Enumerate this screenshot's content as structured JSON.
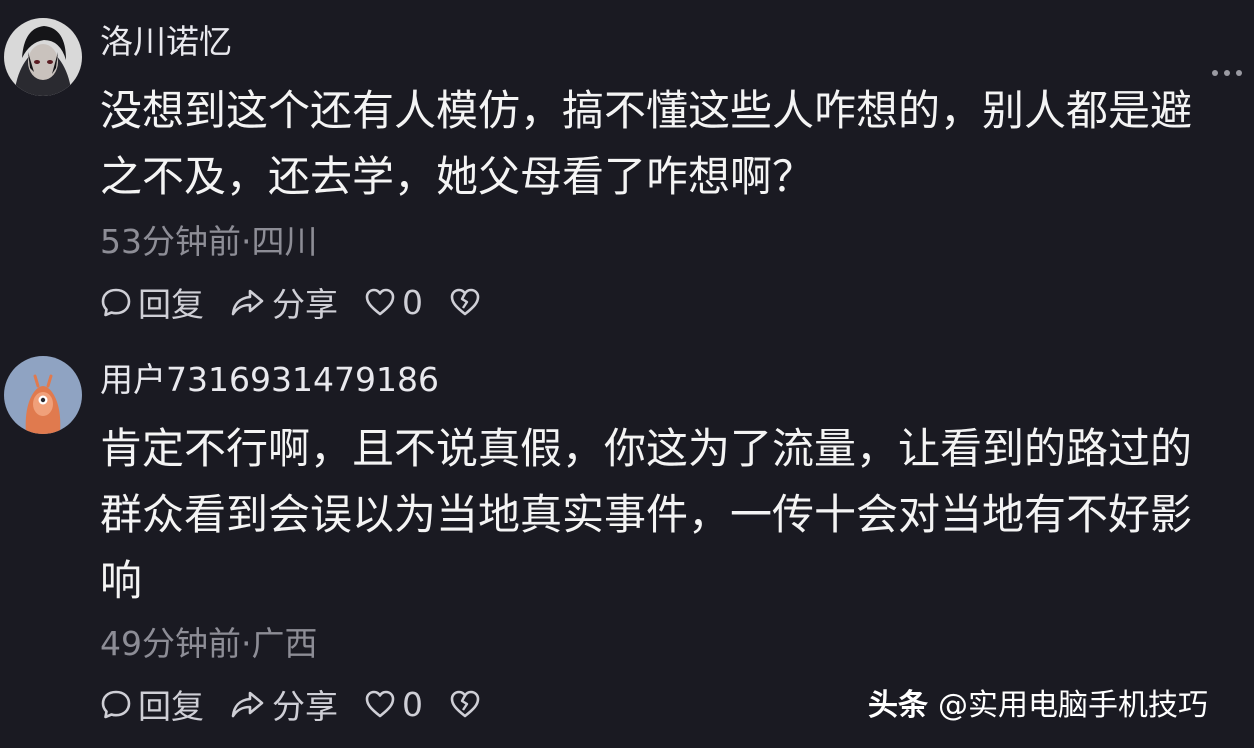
{
  "comments": [
    {
      "username": "洛川诺忆",
      "lines": [
        "没想到这个还有人模仿，搞不懂这些人咋想的，别人都是避",
        "之不及，还去学，她父母看了咋想啊？"
      ],
      "meta": "53分钟前·四川",
      "reply_label": "回复",
      "share_label": "分享",
      "like_count": "0"
    },
    {
      "username": "用户7316931479186",
      "lines": [
        "肯定不行啊，且不说真假，你这为了流量，让看到的路过的",
        "群众看到会误以为当地真实事件，一传十会对当地有不好影",
        "响"
      ],
      "meta": "49分钟前·广西",
      "reply_label": "回复",
      "share_label": "分享",
      "like_count": "0"
    }
  ],
  "watermark": {
    "brand": "头条",
    "handle": "@实用电脑手机技巧"
  },
  "icons": {
    "reply": "comment-bubble-icon",
    "share": "share-arrow-icon",
    "like": "heart-icon",
    "dislike": "broken-heart-icon",
    "more": "more-dots-icon"
  }
}
